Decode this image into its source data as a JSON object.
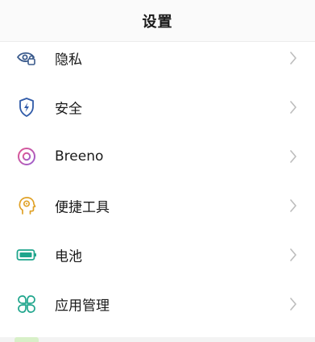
{
  "header": {
    "title": "设置"
  },
  "items": [
    {
      "label": "隐私",
      "icon": "privacy-eye-lock-icon",
      "color": "#3a5a8c"
    },
    {
      "label": "安全",
      "icon": "shield-bolt-icon",
      "color": "#2f5aa8"
    },
    {
      "label": "Breeno",
      "icon": "breeno-ring-icon",
      "color": "#c84fa0"
    },
    {
      "label": "便捷工具",
      "icon": "head-gear-icon",
      "color": "#e0a126"
    },
    {
      "label": "电池",
      "icon": "battery-icon",
      "color": "#1fa58c"
    },
    {
      "label": "应用管理",
      "icon": "app-grid-icon",
      "color": "#1fa58c"
    }
  ],
  "chevron_color": "#bdbdbd"
}
